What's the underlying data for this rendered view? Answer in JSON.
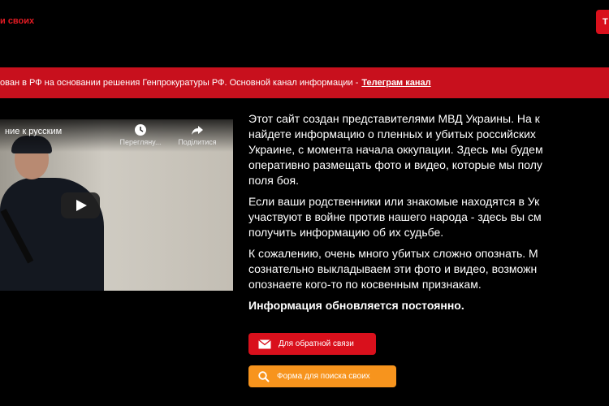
{
  "header": {
    "logo_text": "и своих",
    "right_button_label": "Т"
  },
  "banner": {
    "text": "ован в РФ на основании решения Генпрокуратуры РФ. Основной канал информации -",
    "link_label": "Телеграм канал"
  },
  "video": {
    "title": "ние к русским",
    "watch_later_label": "Переглянy...",
    "share_label": "Поділитися"
  },
  "content": {
    "lines_p1": [
      "Этот сайт создан представителями МВД Украины. На к",
      "найдете информацию о пленных и убитых российских",
      "Украине, с момента начала оккупации. Здесь мы будем",
      "оперативно размещать фото и видео, которые мы полу",
      "поля боя."
    ],
    "lines_p2": [
      "Если ваши родственники или знакомые находятся в Ук",
      "участвуют в войне против нашего народа - здесь вы см",
      "получить информацию об их судьбе."
    ],
    "lines_p3": [
      "К сожалению, очень много убитых сложно опознать. М",
      "сознательно выкладываем эти фото и видео, возможн",
      "опознаете кого-то по косвенным признакам."
    ],
    "updated_note": "Информация обновляется постоянно."
  },
  "buttons": {
    "feedback_label": "Для обратной связи",
    "search_label": "Форма для поиска своих"
  },
  "colors": {
    "background": "#000000",
    "brand_red": "#d9101c",
    "banner_red": "#c8101d",
    "search_orange": "#f7941d"
  }
}
